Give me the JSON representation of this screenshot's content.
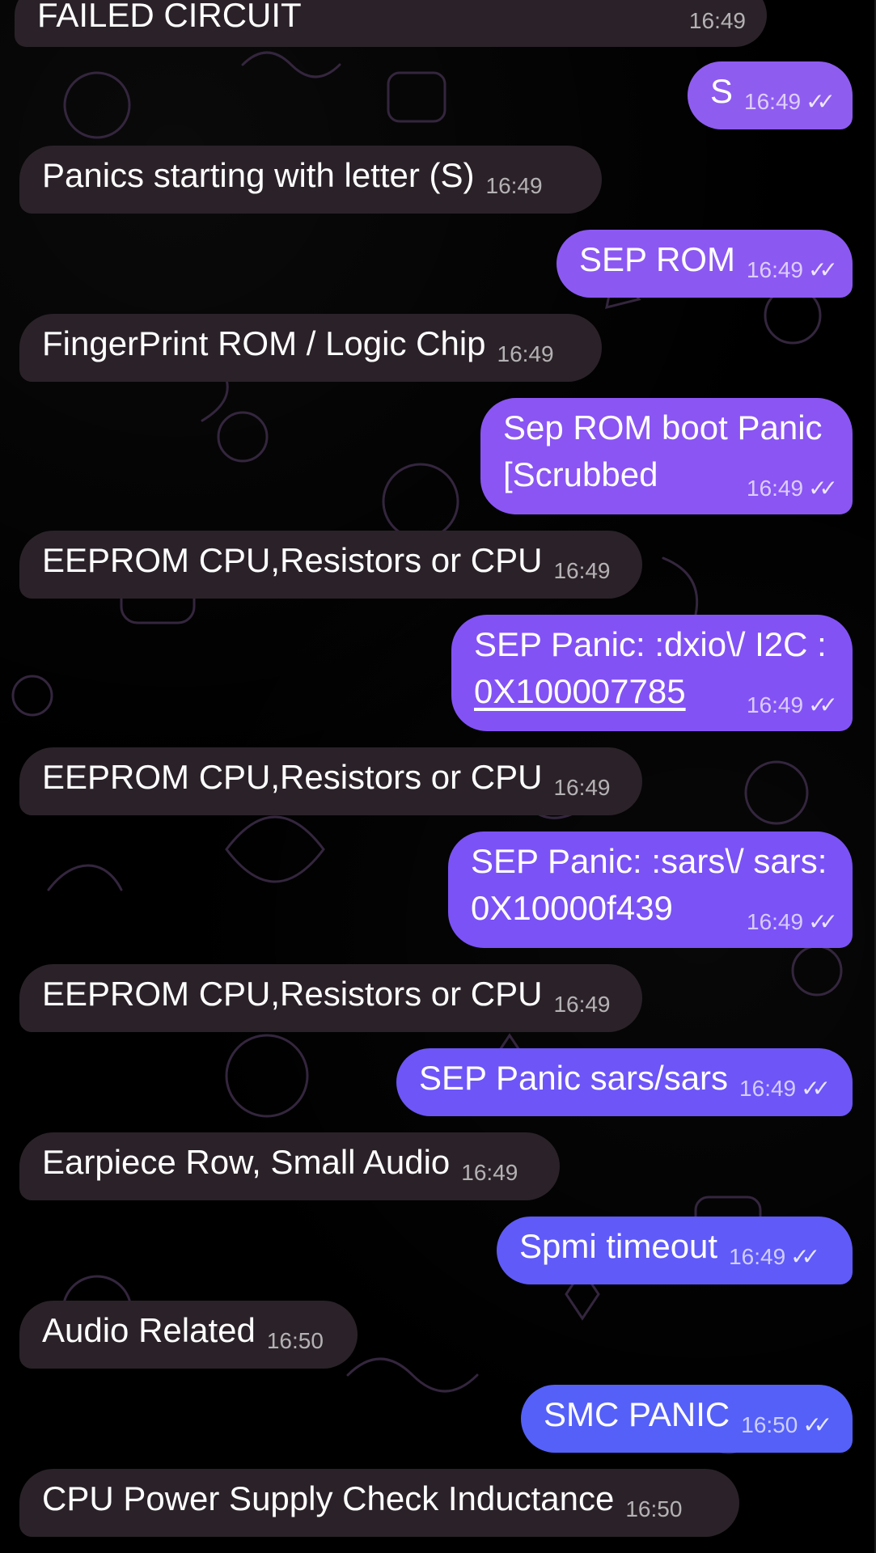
{
  "messages": [
    {
      "dir": "in",
      "text": "FAILED CIRCUIT",
      "time": "16:49"
    },
    {
      "dir": "out",
      "text": "S",
      "time": "16:49",
      "color": "#8f5cf0"
    },
    {
      "dir": "in",
      "text": "Panics starting with letter (S)",
      "time": "16:49"
    },
    {
      "dir": "out",
      "text": "SEP ROM",
      "time": "16:49",
      "color": "#8c58f2"
    },
    {
      "dir": "in",
      "text": "FingerPrint ROM / Logic Chip",
      "time": "16:49"
    },
    {
      "dir": "out",
      "text": "Sep ROM boot Panic\n[Scrubbed",
      "time": "16:49",
      "color": "#8a55f3"
    },
    {
      "dir": "in",
      "text": "EEPROM CPU,Resistors or CPU",
      "time": "16:49"
    },
    {
      "dir": "out",
      "text": "SEP Panic: :dxio\\/ I2C :",
      "text2": "0X100007785",
      "time": "16:49",
      "color": "#8352f5"
    },
    {
      "dir": "in",
      "text": "EEPROM CPU,Resistors or CPU",
      "time": "16:49"
    },
    {
      "dir": "out",
      "text": "SEP Panic: :sars\\/ sars:\n0X10000f439",
      "time": "16:49",
      "color": "#7b52f6"
    },
    {
      "dir": "in",
      "text": "EEPROM CPU,Resistors or CPU",
      "time": "16:49"
    },
    {
      "dir": "out",
      "text": "SEP Panic sars/sars",
      "time": "16:49",
      "color": "#6d55f7"
    },
    {
      "dir": "in",
      "text": "Earpiece Row, Small Audio",
      "time": "16:49"
    },
    {
      "dir": "out",
      "text": "Spmi timeout",
      "time": "16:49",
      "color": "#605af8"
    },
    {
      "dir": "in",
      "text": "Audio Related",
      "time": "16:50"
    },
    {
      "dir": "out",
      "text": "SMC PANIC",
      "time": "16:50",
      "color": "#5560f8"
    },
    {
      "dir": "in",
      "text": "CPU Power Supply Check Inductance",
      "time": "16:50"
    }
  ],
  "read_receipt_icon": "double-check-icon"
}
